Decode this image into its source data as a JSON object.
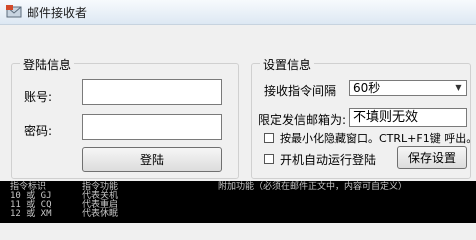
{
  "window": {
    "title": "邮件接收者"
  },
  "login": {
    "group_title": "登陆信息",
    "account_label": "账号:",
    "account_value": "",
    "password_label": "密码:",
    "password_value": "",
    "login_button": "登陆"
  },
  "settings": {
    "group_title": "设置信息",
    "interval_label": "接收指令间隔",
    "interval_value": "60秒",
    "sender_label": "限定发信邮箱为:",
    "sender_value": "不填则无效",
    "minimize_hide_label": "按最小化隐藏窗口。CTRL+F1键 呼出。",
    "minimize_hide_checked": false,
    "autostart_label": "开机自动运行登陆",
    "autostart_checked": false,
    "save_button": "保存设置"
  },
  "console": {
    "header": {
      "col1": "指令标识",
      "col2": "指令功能",
      "col3": "附加功能（必须在邮件正文中，内容可自定义）"
    },
    "rows": [
      {
        "col1": "10 或 GJ",
        "col2": "代表关机"
      },
      {
        "col1": "11 或 CQ",
        "col2": "代表重启"
      },
      {
        "col1": "12 或 XM",
        "col2": "代表休眠"
      }
    ]
  }
}
